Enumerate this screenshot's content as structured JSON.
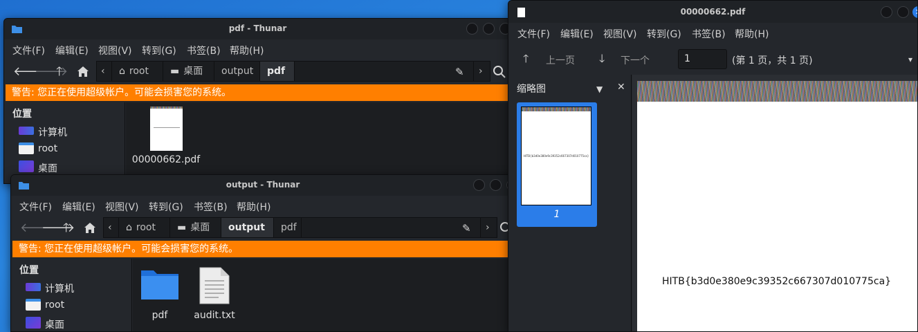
{
  "thunar_pdf": {
    "title": "pdf - Thunar",
    "menu": [
      "文件(F)",
      "编辑(E)",
      "视图(V)",
      "转到(G)",
      "书签(B)",
      "帮助(H)"
    ],
    "crumbs": [
      "root",
      "桌面",
      "output",
      "pdf"
    ],
    "warning": "警告: 您正在使用超级帐户。可能会损害您的系统。",
    "places_heading": "位置",
    "places": [
      "计算机",
      "root",
      "桌面"
    ],
    "files": [
      {
        "name": "00000662.pdf",
        "icon": "pdf-file-icon"
      }
    ]
  },
  "thunar_output": {
    "title": "output - Thunar",
    "menu": [
      "文件(F)",
      "编辑(E)",
      "视图(V)",
      "转到(G)",
      "书签(B)",
      "帮助(H)"
    ],
    "crumbs": [
      "root",
      "桌面",
      "output",
      "pdf"
    ],
    "warning": "警告: 您正在使用超级帐户。可能会损害您的系统。",
    "places_heading": "位置",
    "places": [
      "计算机",
      "root",
      "桌面"
    ],
    "files": [
      {
        "name": "pdf",
        "icon": "folder-icon"
      },
      {
        "name": "audit.txt",
        "icon": "text-file-icon"
      }
    ]
  },
  "evince": {
    "title": "00000662.pdf",
    "menu": [
      "文件(F)",
      "编辑(E)",
      "视图(V)",
      "转到(G)",
      "书签(B)",
      "帮助(H)"
    ],
    "prev_label": "上一页",
    "next_label": "下一个",
    "page_value": "1",
    "page_info": "(第 1 页，共 1 页)",
    "sidebar_label": "缩略图",
    "thumb_page": "1",
    "thumb_text": "HITB{b3d0e380e9c39352c667307d010775ca}",
    "page_text": "HITB{b3d0e380e9c39352c667307d010775ca}"
  },
  "colors": {
    "accent": "#2b7de9",
    "warning": "#ff7f00",
    "window_bg": "#24272c"
  }
}
